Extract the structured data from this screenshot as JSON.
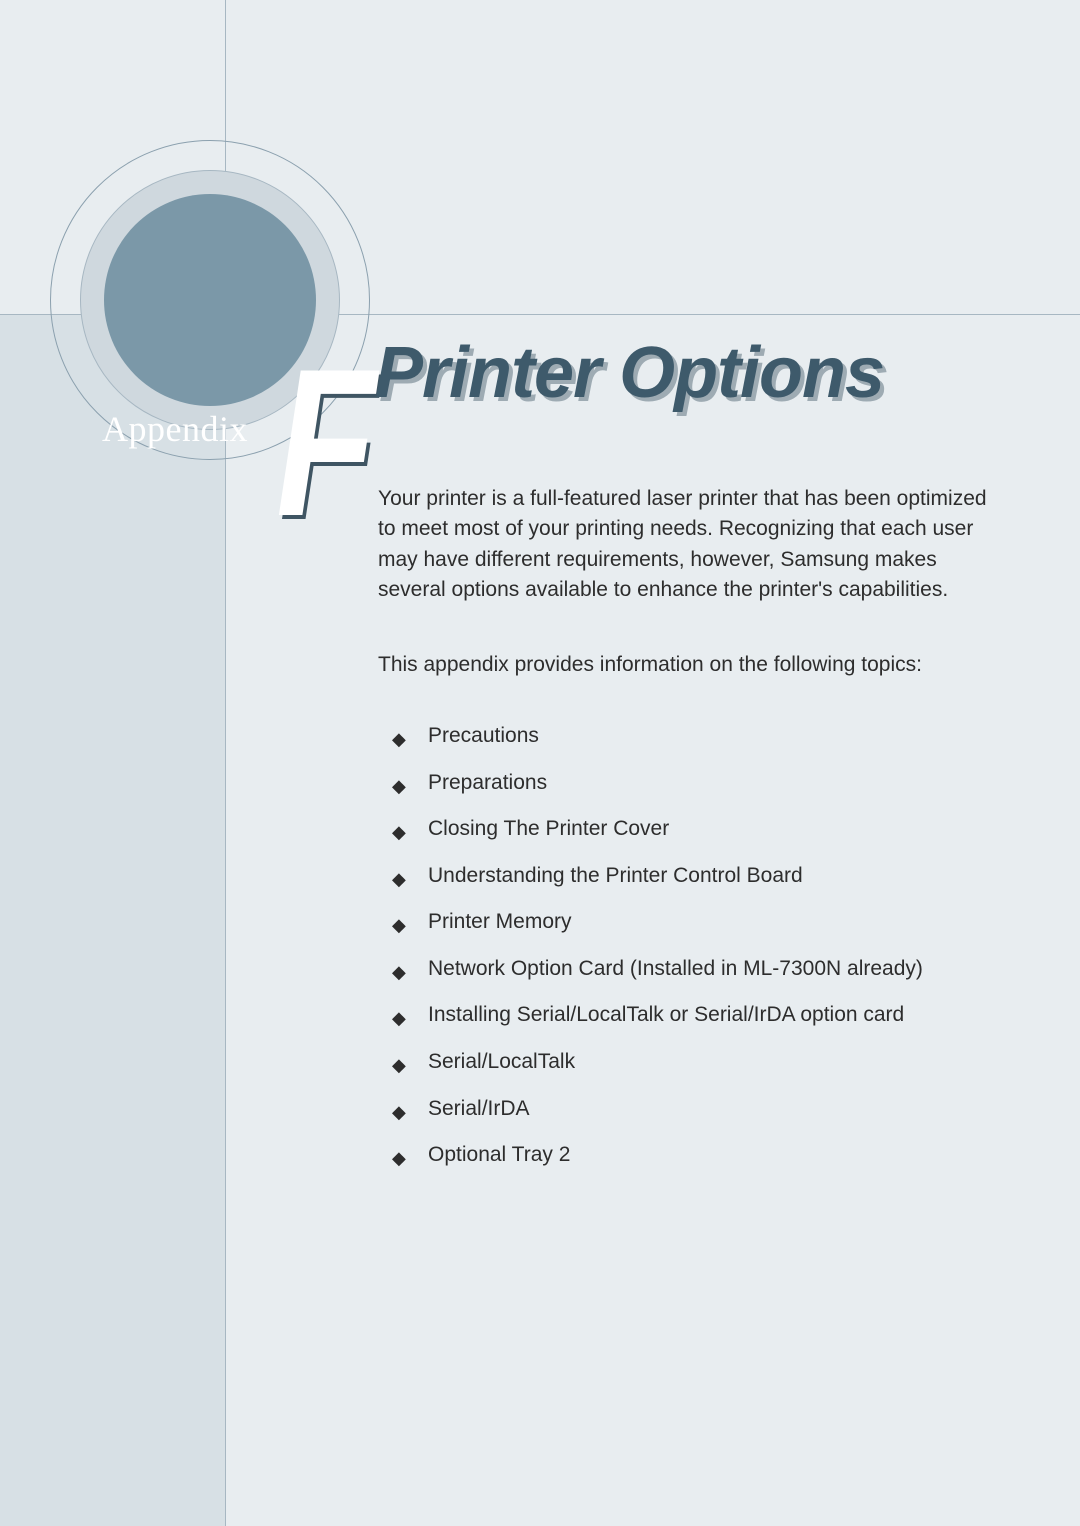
{
  "ornament": {
    "appendix_label": "Appendix",
    "letter": "F"
  },
  "title": "Printer Options",
  "intro": "Your printer is a full-featured laser printer that has been optimized to meet most of your printing needs. Recognizing that each user may have different requirements, however, Samsung makes several options available to enhance the printer's capabilities.",
  "leadline": "This appendix provides information on the following topics:",
  "topics": [
    "Precautions",
    "Preparations",
    "Closing The Printer Cover",
    "Understanding the Printer Control Board",
    "Printer Memory",
    "Network Option Card (Installed in ML-7300N already)",
    "Installing Serial/LocalTalk or Serial/IrDA option card",
    "Serial/LocalTalk",
    "Serial/IrDA",
    "Optional Tray 2"
  ]
}
